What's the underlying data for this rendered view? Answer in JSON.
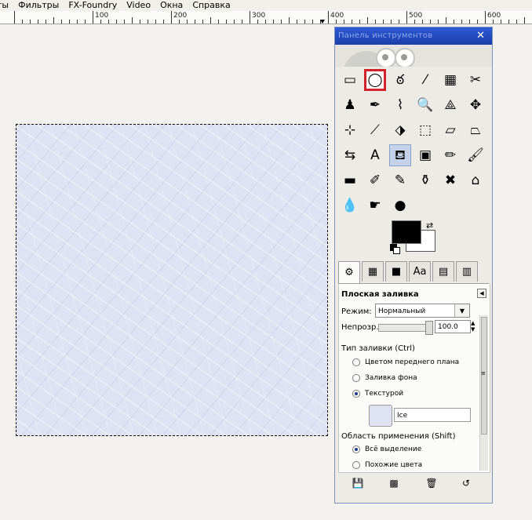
{
  "menu": {
    "items": [
      "ты",
      "Фильтры",
      "FX-Foundry",
      "Video",
      "Окна",
      "Справка"
    ]
  },
  "ruler": {
    "labels": [
      "100",
      "200",
      "300",
      "400",
      "500",
      "600"
    ]
  },
  "toolbox": {
    "title": "Панель инструментов",
    "close": "✕",
    "tools": [
      {
        "name": "rect-select-icon",
        "glyph": "▭"
      },
      {
        "name": "ellipse-select-icon",
        "glyph": "◯",
        "selected": true
      },
      {
        "name": "free-select-icon",
        "glyph": "ఠ"
      },
      {
        "name": "fuzzy-select-icon",
        "glyph": "⁄"
      },
      {
        "name": "select-by-color-icon",
        "glyph": "▦"
      },
      {
        "name": "scissors-icon",
        "glyph": "✂"
      },
      {
        "name": "foreground-select-icon",
        "glyph": "♟"
      },
      {
        "name": "paths-icon",
        "glyph": "✒"
      },
      {
        "name": "color-picker-icon",
        "glyph": "⌇"
      },
      {
        "name": "zoom-icon",
        "glyph": "🔍"
      },
      {
        "name": "measure-icon",
        "glyph": "⟁"
      },
      {
        "name": "move-icon",
        "glyph": "✥"
      },
      {
        "name": "align-icon",
        "glyph": "⊹"
      },
      {
        "name": "crop-icon",
        "glyph": "⟋"
      },
      {
        "name": "rotate-icon",
        "glyph": "⬗"
      },
      {
        "name": "scale-icon",
        "glyph": "⬚"
      },
      {
        "name": "shear-icon",
        "glyph": "▱"
      },
      {
        "name": "perspective-icon",
        "glyph": "⏢"
      },
      {
        "name": "flip-icon",
        "glyph": "⇆"
      },
      {
        "name": "text-icon",
        "glyph": "A"
      },
      {
        "name": "bucket-fill-icon",
        "glyph": "⛾",
        "pressed": true
      },
      {
        "name": "blend-icon",
        "glyph": "▣"
      },
      {
        "name": "pencil-icon",
        "glyph": "✏"
      },
      {
        "name": "paintbrush-icon",
        "glyph": "🖌"
      },
      {
        "name": "eraser-icon",
        "glyph": "▬"
      },
      {
        "name": "airbrush-icon",
        "glyph": "✐"
      },
      {
        "name": "ink-icon",
        "glyph": "✎"
      },
      {
        "name": "clone-icon",
        "glyph": "⚱"
      },
      {
        "name": "heal-icon",
        "glyph": "✖"
      },
      {
        "name": "perspective-clone-icon",
        "glyph": "⌂"
      },
      {
        "name": "blur-icon",
        "glyph": "💧"
      },
      {
        "name": "smudge-icon",
        "glyph": "☛"
      },
      {
        "name": "dodge-burn-icon",
        "glyph": "●"
      }
    ],
    "colors": {
      "foreground": "#000000",
      "background": "#ffffff",
      "selection_highlight": "#d3232a"
    },
    "tabs": [
      {
        "name": "tab-tool-options",
        "glyph": "⚙"
      },
      {
        "name": "tab-brushes",
        "glyph": "▦"
      },
      {
        "name": "tab-patterns",
        "glyph": "■"
      },
      {
        "name": "tab-fonts",
        "glyph": "Aa"
      },
      {
        "name": "tab-gradients",
        "glyph": "▤"
      },
      {
        "name": "tab-documents",
        "glyph": "▥"
      }
    ],
    "options": {
      "title": "Плоская заливка",
      "mode_label": "Режим:",
      "mode_value": "Нормальный",
      "opacity_label": "Непрозр.:",
      "opacity_value": "100.0",
      "fill_type_label": "Тип заливки  (Ctrl)",
      "fill_fg": "Цветом переднего плана",
      "fill_bg": "Заливка фона",
      "fill_pattern": "Текстурой",
      "pattern_name": "Ice",
      "area_label": "Область применения  (Shift)",
      "area_selection": "Всё выделение",
      "area_similar": "Похожие цвета"
    },
    "bottom_buttons": [
      "save-icon",
      "restore-icon",
      "delete-icon",
      "reset-icon"
    ]
  }
}
